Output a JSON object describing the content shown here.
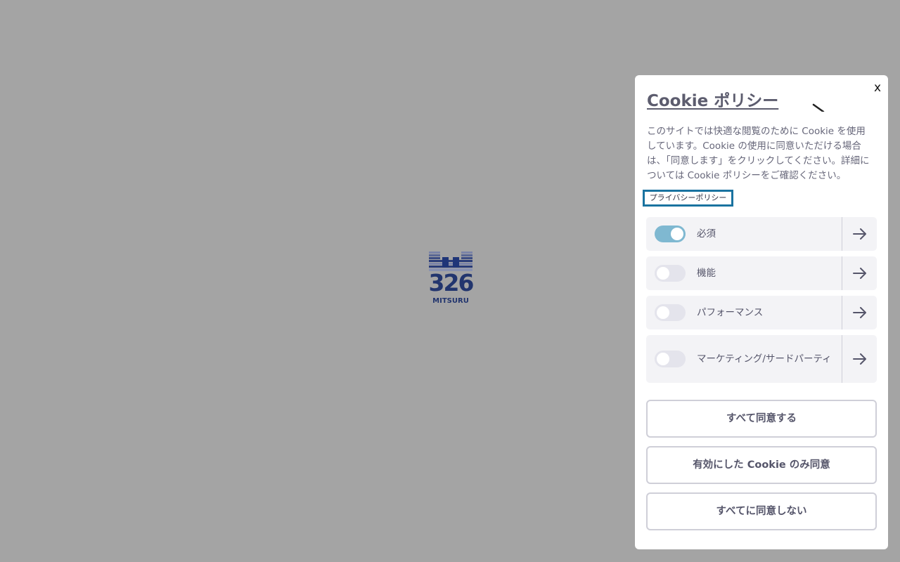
{
  "logo": {
    "text": "MITSURU",
    "number": "326",
    "color": "#22356e"
  },
  "cookie_panel": {
    "close_label": "x",
    "title": "Cookie ポリシー",
    "description": "このサイトでは快適な閲覧のために Cookie を使用しています。Cookie の使用に同意いただける場合は、「同意します」をクリックしてください。詳細については Cookie ポリシーをご確認ください。",
    "privacy_link": "プライバシーポリシー",
    "categories": [
      {
        "label": "必須",
        "enabled": true
      },
      {
        "label": "機能",
        "enabled": false
      },
      {
        "label": "パフォーマンス",
        "enabled": false
      },
      {
        "label": "マーケティング/サードパーティ",
        "enabled": false
      }
    ],
    "buttons": {
      "accept_all": "すべて同意する",
      "accept_selected": "有効にした Cookie のみ同意",
      "reject_all": "すべてに同意しない"
    },
    "colors": {
      "toggle_on": "#7fb8d1",
      "toggle_off": "#e4e4ec",
      "link_border": "#1a73a0",
      "overlay": "#a4a4a4"
    }
  }
}
